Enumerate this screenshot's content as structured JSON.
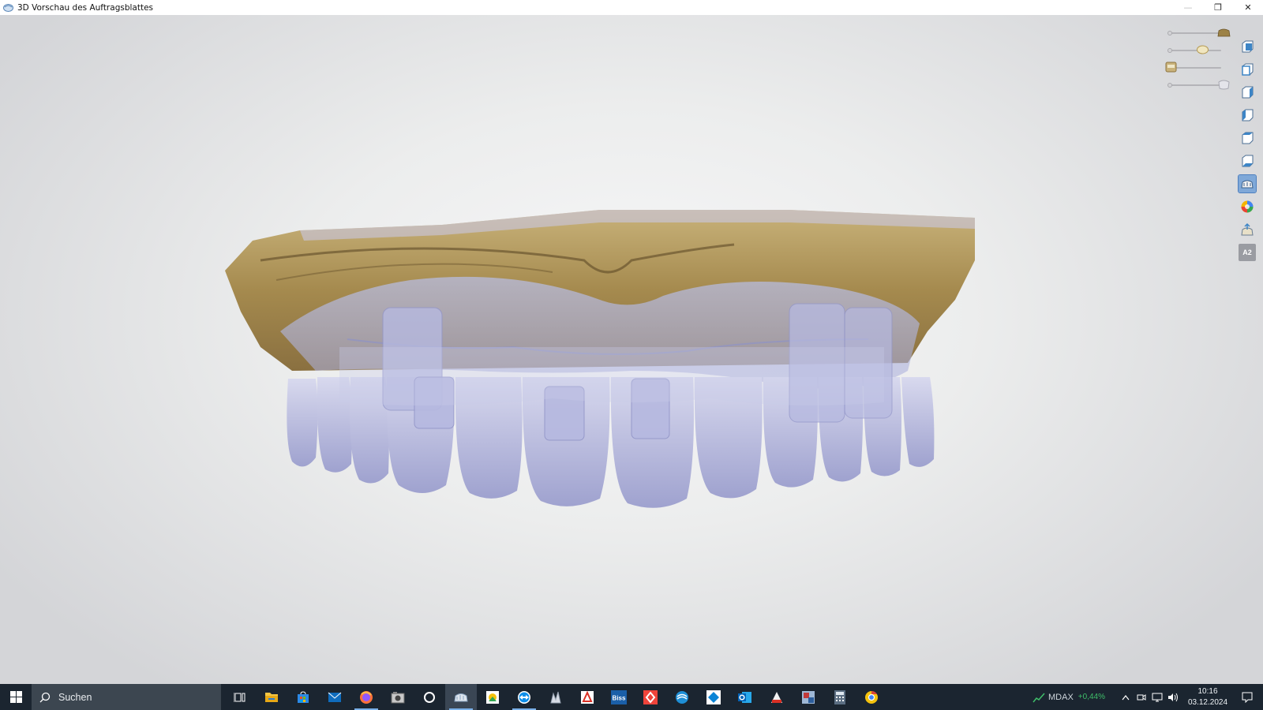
{
  "window": {
    "title": "3D Vorschau des Auftragsblattes",
    "controls": {
      "minimize": "—",
      "restore": "❐",
      "close": "✕"
    }
  },
  "viewer": {
    "sliders": [
      {
        "name": "model-opacity-slider",
        "icon": "model-base-icon",
        "value": 1.0
      },
      {
        "name": "jaw-opacity-slider",
        "icon": "jaw-icon",
        "value": 0.55
      },
      {
        "name": "gingiva-opacity-slider",
        "icon": "gingiva-icon",
        "value": 0.0
      },
      {
        "name": "teeth-opacity-slider",
        "icon": "teeth-icon",
        "value": 1.0
      }
    ],
    "toolbar": [
      {
        "name": "view-front-button",
        "icon": "cube-front-icon",
        "active": false
      },
      {
        "name": "view-back-button",
        "icon": "cube-back-icon",
        "active": false
      },
      {
        "name": "view-left-button",
        "icon": "cube-left-icon",
        "active": false
      },
      {
        "name": "view-right-button",
        "icon": "cube-right-icon",
        "active": false
      },
      {
        "name": "view-top-button",
        "icon": "cube-top-icon",
        "active": false
      },
      {
        "name": "view-bottom-button",
        "icon": "cube-bottom-icon",
        "active": false
      },
      {
        "name": "model-view-button",
        "icon": "model-view-icon",
        "active": true
      },
      {
        "name": "color-button",
        "icon": "color-wheel-icon",
        "active": false
      },
      {
        "name": "screenshot-button",
        "icon": "screenshot-icon",
        "active": false
      },
      {
        "name": "shade-button",
        "icon": "shade-icon",
        "label": "A2",
        "active": false
      }
    ]
  },
  "taskbar": {
    "search_placeholder": "Suchen",
    "apps": [
      {
        "name": "task-view",
        "icon": "task-view-icon"
      },
      {
        "name": "file-explorer",
        "icon": "folder-icon"
      },
      {
        "name": "store",
        "icon": "store-icon"
      },
      {
        "name": "mail",
        "icon": "mail-icon"
      },
      {
        "name": "firefox",
        "icon": "firefox-icon"
      },
      {
        "name": "camera-app",
        "icon": "camera-icon"
      },
      {
        "name": "cortana",
        "icon": "circle-icon"
      },
      {
        "name": "dental-viewer",
        "icon": "tooth-model-icon"
      },
      {
        "name": "photo-app",
        "icon": "photo-icon"
      },
      {
        "name": "teamviewer",
        "icon": "teamviewer-icon"
      },
      {
        "name": "scan-app",
        "icon": "scan-icon"
      },
      {
        "name": "pdf-app",
        "icon": "pdf-icon"
      },
      {
        "name": "biss-app",
        "icon": "biss-icon",
        "label": "Biss"
      },
      {
        "name": "anydesk",
        "icon": "anydesk-icon"
      },
      {
        "name": "edge",
        "icon": "edge-icon"
      },
      {
        "name": "dropbox",
        "icon": "dropbox-icon"
      },
      {
        "name": "outlook",
        "icon": "outlook-icon"
      },
      {
        "name": "adobe-app",
        "icon": "adobe-icon"
      },
      {
        "name": "network-app",
        "icon": "network-icon"
      },
      {
        "name": "calculator",
        "icon": "calculator-icon"
      },
      {
        "name": "chrome",
        "icon": "chrome-icon"
      }
    ],
    "ticker": {
      "name": "MDAX",
      "change": "+0,44%"
    },
    "clock": {
      "time": "10:16",
      "date": "03.12.2024"
    }
  },
  "colors": {
    "accent": "#7fa8d8",
    "taskbar": "#1b2530",
    "gold_model": "#b39a5e",
    "teeth": "#a8abd8"
  }
}
